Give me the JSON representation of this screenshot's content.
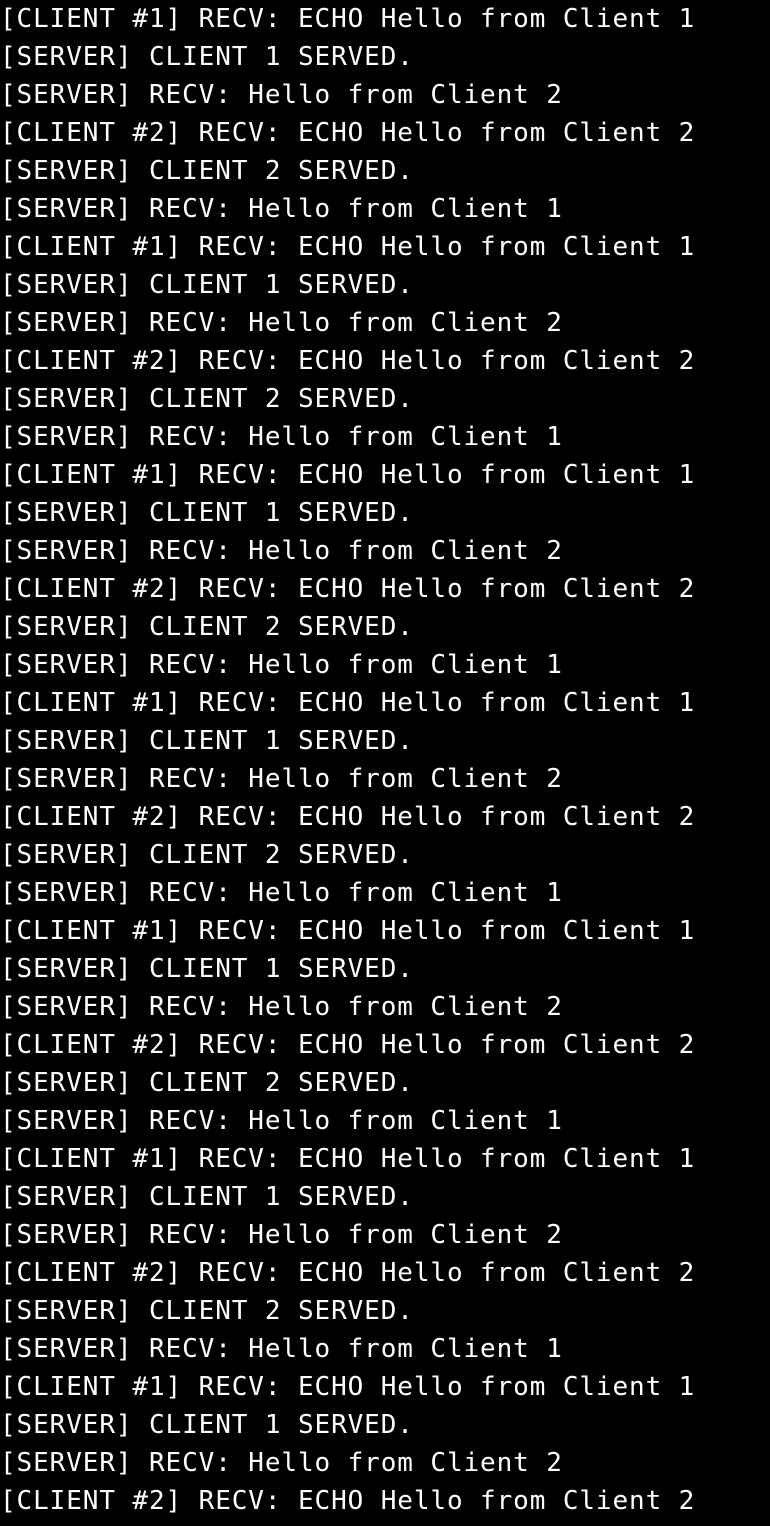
{
  "colors": {
    "background": "#000000",
    "text": "#ffffff"
  },
  "terminal": {
    "lines": [
      "[CLIENT #1] RECV: ECHO Hello from Client 1",
      "[SERVER] CLIENT 1 SERVED.",
      "[SERVER] RECV: Hello from Client 2",
      "[CLIENT #2] RECV: ECHO Hello from Client 2",
      "[SERVER] CLIENT 2 SERVED.",
      "[SERVER] RECV: Hello from Client 1",
      "[CLIENT #1] RECV: ECHO Hello from Client 1",
      "[SERVER] CLIENT 1 SERVED.",
      "[SERVER] RECV: Hello from Client 2",
      "[CLIENT #2] RECV: ECHO Hello from Client 2",
      "[SERVER] CLIENT 2 SERVED.",
      "[SERVER] RECV: Hello from Client 1",
      "[CLIENT #1] RECV: ECHO Hello from Client 1",
      "[SERVER] CLIENT 1 SERVED.",
      "[SERVER] RECV: Hello from Client 2",
      "[CLIENT #2] RECV: ECHO Hello from Client 2",
      "[SERVER] CLIENT 2 SERVED.",
      "[SERVER] RECV: Hello from Client 1",
      "[CLIENT #1] RECV: ECHO Hello from Client 1",
      "[SERVER] CLIENT 1 SERVED.",
      "[SERVER] RECV: Hello from Client 2",
      "[CLIENT #2] RECV: ECHO Hello from Client 2",
      "[SERVER] CLIENT 2 SERVED.",
      "[SERVER] RECV: Hello from Client 1",
      "[CLIENT #1] RECV: ECHO Hello from Client 1",
      "[SERVER] CLIENT 1 SERVED.",
      "[SERVER] RECV: Hello from Client 2",
      "[CLIENT #2] RECV: ECHO Hello from Client 2",
      "[SERVER] CLIENT 2 SERVED.",
      "[SERVER] RECV: Hello from Client 1",
      "[CLIENT #1] RECV: ECHO Hello from Client 1",
      "[SERVER] CLIENT 1 SERVED.",
      "[SERVER] RECV: Hello from Client 2",
      "[CLIENT #2] RECV: ECHO Hello from Client 2",
      "[SERVER] CLIENT 2 SERVED.",
      "[SERVER] RECV: Hello from Client 1",
      "[CLIENT #1] RECV: ECHO Hello from Client 1",
      "[SERVER] CLIENT 1 SERVED.",
      "[SERVER] RECV: Hello from Client 2",
      "[CLIENT #2] RECV: ECHO Hello from Client 2"
    ]
  }
}
